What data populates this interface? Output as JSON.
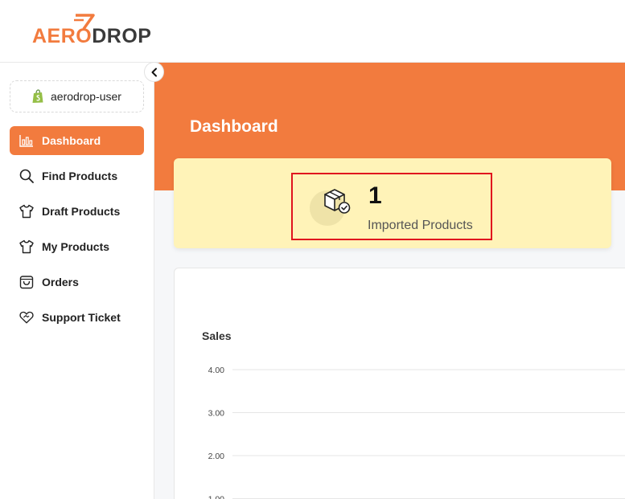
{
  "logo": {
    "part1": "AERO",
    "part2": "DROP"
  },
  "store": {
    "name": "aerodrop-user"
  },
  "nav": [
    {
      "label": "Dashboard",
      "icon": "bar-chart-icon",
      "active": true
    },
    {
      "label": "Find Products",
      "icon": "search-icon",
      "active": false
    },
    {
      "label": "Draft Products",
      "icon": "shirt-icon",
      "active": false
    },
    {
      "label": "My Products",
      "icon": "shirt-icon",
      "active": false
    },
    {
      "label": "Orders",
      "icon": "shopping-bag-icon",
      "active": false
    },
    {
      "label": "Support Ticket",
      "icon": "heart-handshake-icon",
      "active": false
    }
  ],
  "main": {
    "title": "Dashboard",
    "stat": {
      "value": "1",
      "label": "Imported Products",
      "icon": "box-check-icon"
    }
  },
  "colors": {
    "accent": "#f27b3e",
    "stat_bg": "#fff3b8",
    "highlight": "#e0141e"
  },
  "chart_data": {
    "type": "line",
    "title": "Sales",
    "y_ticks": [
      "4.00",
      "3.00",
      "2.00",
      "1.00"
    ],
    "y_tick_values": [
      4,
      3,
      2,
      1
    ],
    "grid": true,
    "series": []
  }
}
